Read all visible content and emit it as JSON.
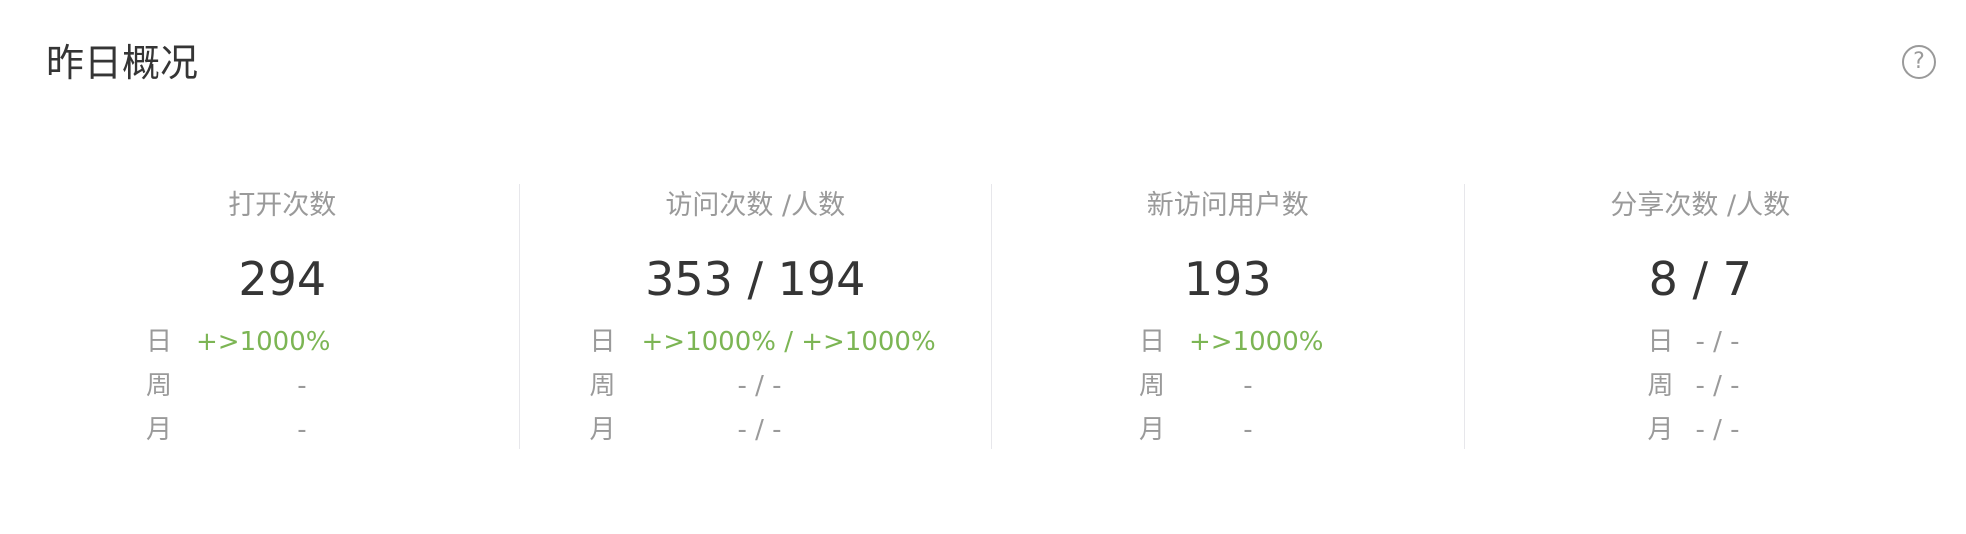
{
  "panel": {
    "title": "昨日概况",
    "help_icon": "?"
  },
  "colors": {
    "positive": "#7cb554",
    "muted": "#9a9a9a",
    "text": "#353535",
    "divider": "#e7e7eb"
  },
  "icons": {
    "help": "question-circle-icon"
  },
  "metrics": [
    {
      "label": "打开次数",
      "value": "294",
      "rows": [
        {
          "period": "日",
          "change": "+>1000%"
        },
        {
          "period": "周",
          "change": "-"
        },
        {
          "period": "月",
          "change": "-"
        }
      ]
    },
    {
      "label": "访问次数 /人数",
      "value": "353 / 194",
      "rows": [
        {
          "period": "日",
          "change": "+>1000% / +>1000%"
        },
        {
          "period": "周",
          "change": "- / -"
        },
        {
          "period": "月",
          "change": "- / -"
        }
      ]
    },
    {
      "label": "新访问用户数",
      "value": "193",
      "rows": [
        {
          "period": "日",
          "change": "+>1000%"
        },
        {
          "period": "周",
          "change": "-"
        },
        {
          "period": "月",
          "change": "-"
        }
      ]
    },
    {
      "label": "分享次数 /人数",
      "value": "8 / 7",
      "rows": [
        {
          "period": "日",
          "change": "- / -"
        },
        {
          "period": "周",
          "change": "- / -"
        },
        {
          "period": "月",
          "change": "- / -"
        }
      ]
    }
  ]
}
